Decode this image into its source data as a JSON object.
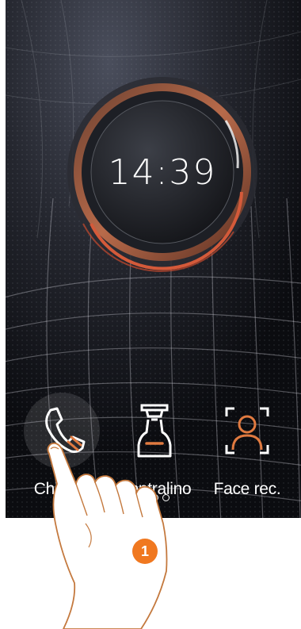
{
  "clock": {
    "time": "14:39"
  },
  "apps": [
    {
      "id": "chiama",
      "label": "Chiama",
      "icon": "phone-icon"
    },
    {
      "id": "centralino",
      "label": "Centralino",
      "icon": "switchboard-operator-icon"
    },
    {
      "id": "face-rec",
      "label": "Face rec.",
      "icon": "face-recognition-icon"
    }
  ],
  "pager": {
    "pages": 3,
    "current": 1
  },
  "callout": {
    "step": "1",
    "color": "#f07820"
  },
  "colors": {
    "accent": "#e07a40",
    "ring": "#c85a3a",
    "badge": "#f07820"
  }
}
